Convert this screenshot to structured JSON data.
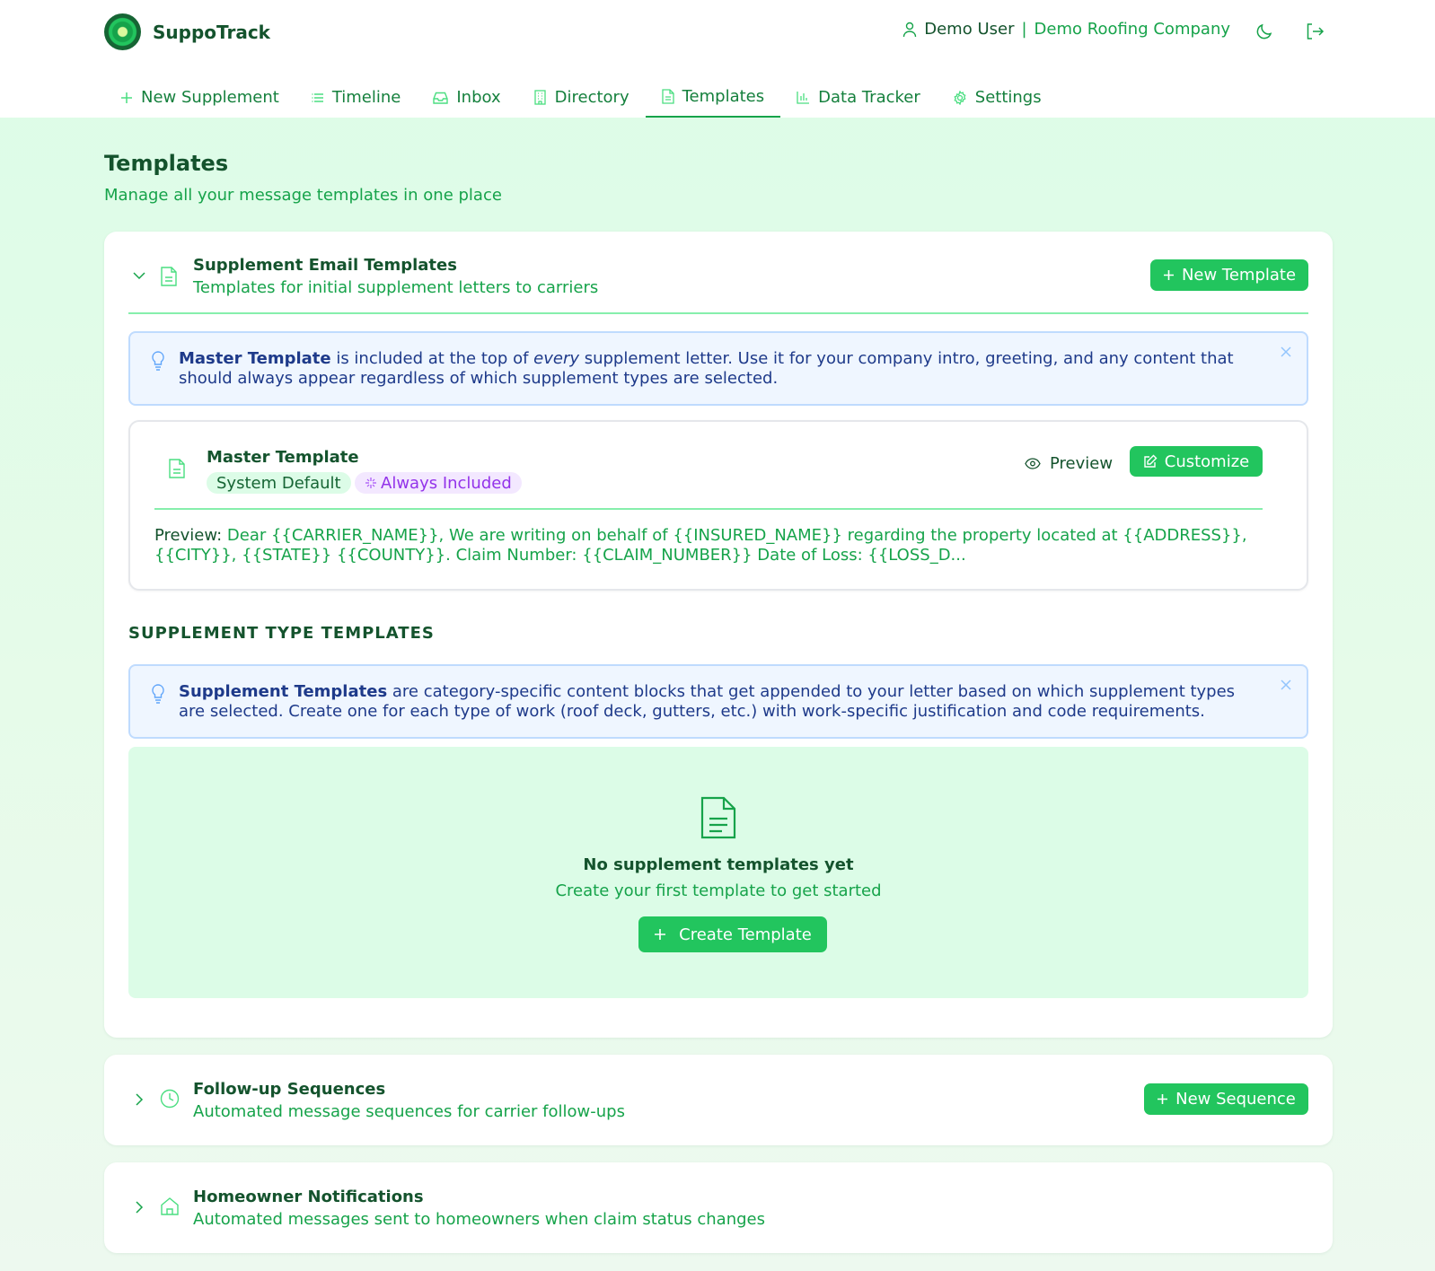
{
  "app": {
    "name": "SuppoTrack",
    "user_name": "Demo User",
    "separator": "|",
    "company": "Demo Roofing Company"
  },
  "icons": {
    "user": "user-icon",
    "theme": "moon-icon",
    "logout": "logout-icon"
  },
  "nav": {
    "items": [
      {
        "label": "New Supplement",
        "icon": "plus-icon"
      },
      {
        "label": "Timeline",
        "icon": "list-icon"
      },
      {
        "label": "Inbox",
        "icon": "inbox-icon"
      },
      {
        "label": "Directory",
        "icon": "building-icon"
      },
      {
        "label": "Templates",
        "icon": "file-text-icon",
        "active": true
      },
      {
        "label": "Data Tracker",
        "icon": "bar-chart-icon"
      },
      {
        "label": "Settings",
        "icon": "gear-icon"
      }
    ]
  },
  "page": {
    "title": "Templates",
    "subtitle": "Manage all your message templates in one place"
  },
  "email_section": {
    "title": "Supplement Email Templates",
    "description": "Templates for initial supplement letters to carriers",
    "new_button": "New Template",
    "expanded": true,
    "info": {
      "bold": "Master Template",
      "text_before_em": " is included at the top of ",
      "em": "every",
      "text_after_em": " supplement letter. Use it for your company intro, greeting, and any content that should always appear regardless of which supplement types are selected."
    },
    "master": {
      "title": "Master Template",
      "badge_default": "System Default",
      "badge_always": "Always Included",
      "preview_button": "Preview",
      "customize_button": "Customize",
      "preview_label": "Preview:",
      "preview_text": "Dear {{CARRIER_NAME}}, We are writing on behalf of {{INSURED_NAME}} regarding the property located at {{ADDRESS}}, {{CITY}}, {{STATE}} {{COUNTY}}. Claim Number: {{CLAIM_NUMBER}} Date of Loss: {{LOSS_D..."
    },
    "type_heading": "SUPPLEMENT TYPE TEMPLATES",
    "type_info": {
      "bold": "Supplement Templates",
      "text": " are category-specific content blocks that get appended to your letter based on which supplement types are selected. Create one for each type of work (roof deck, gutters, etc.) with work-specific justification and code requirements."
    },
    "empty": {
      "title": "No supplement templates yet",
      "subtitle": "Create your first template to get started",
      "button": "Create Template"
    }
  },
  "followup_section": {
    "title": "Follow-up Sequences",
    "description": "Automated message sequences for carrier follow-ups",
    "new_button": "New Sequence",
    "expanded": false
  },
  "homeowner_section": {
    "title": "Homeowner Notifications",
    "description": "Automated messages sent to homeowners when claim status changes",
    "expanded": false
  },
  "colors": {
    "primary": "#22c55e",
    "primary_dark": "#14532d",
    "accent_text": "#16a34a",
    "background": "#dcfce7",
    "info_bg": "#eff6ff",
    "info_border": "#bfdbfe",
    "badge_purple": "#9333ea"
  }
}
